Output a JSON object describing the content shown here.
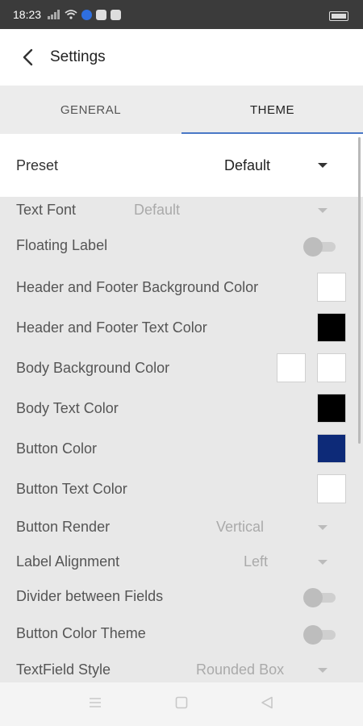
{
  "status_bar": {
    "time": "18:23",
    "icons": [
      "signal-icon",
      "wifi-icon",
      "notification-icon",
      "gallery-icon",
      "download-icon",
      "battery-icon"
    ]
  },
  "header": {
    "title": "Settings",
    "back_icon": "chevron-left-icon"
  },
  "tabs": [
    {
      "label": "GENERAL",
      "active": false
    },
    {
      "label": "THEME",
      "active": true
    }
  ],
  "preset": {
    "label": "Preset",
    "value": "Default"
  },
  "settings": {
    "text_font": {
      "label": "Text Font",
      "value": "Default"
    },
    "floating_label": {
      "label": "Floating Label",
      "on": false
    },
    "header_footer_bg": {
      "label": "Header and Footer Background Color",
      "color": "#ffffff"
    },
    "header_footer_text": {
      "label": "Header and Footer Text Color",
      "color": "#000000"
    },
    "body_bg": {
      "label": "Body Background Color",
      "color": "#ffffff",
      "color2": "#ffffff"
    },
    "body_text": {
      "label": "Body Text Color",
      "color": "#000000"
    },
    "button_color": {
      "label": "Button Color",
      "color": "#0d2a78"
    },
    "button_text": {
      "label": "Button Text Color",
      "color": "#ffffff"
    },
    "button_render": {
      "label": "Button Render",
      "value": "Vertical"
    },
    "label_alignment": {
      "label": "Label Alignment",
      "value": "Left"
    },
    "divider": {
      "label": "Divider between Fields",
      "on": false
    },
    "button_color_theme": {
      "label": "Button Color Theme",
      "on": false
    },
    "textfield_style": {
      "label": "TextField Style",
      "value": "Rounded Box"
    }
  },
  "colors": {
    "accent": "#4a78c6",
    "tab_bg": "#ececec",
    "body_bg": "#e8e8e8"
  },
  "nav": [
    "menu-icon",
    "home-icon",
    "back-icon"
  ]
}
